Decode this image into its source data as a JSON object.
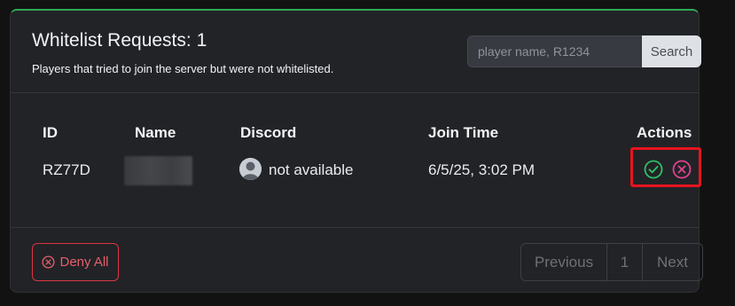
{
  "header": {
    "title": "Whitelist Requests: 1",
    "subtitle": "Players that tried to join the server but were not whitelisted."
  },
  "search": {
    "placeholder": "player name, R1234",
    "button_label": "Search"
  },
  "table": {
    "columns": [
      "ID",
      "Name",
      "Discord",
      "Join Time",
      "Actions"
    ],
    "rows": [
      {
        "id": "RZ77D",
        "name": "",
        "discord": "not available",
        "join_time": "6/5/25, 3:02 PM"
      }
    ]
  },
  "footer": {
    "deny_all_label": "Deny All",
    "pagination": {
      "previous": "Previous",
      "current": "1",
      "next": "Next"
    }
  },
  "colors": {
    "accent": "#2fa85a",
    "approve": "#2fbf6a",
    "deny": "#e0428f",
    "danger": "#dc3545",
    "highlight": "#e8141f"
  }
}
